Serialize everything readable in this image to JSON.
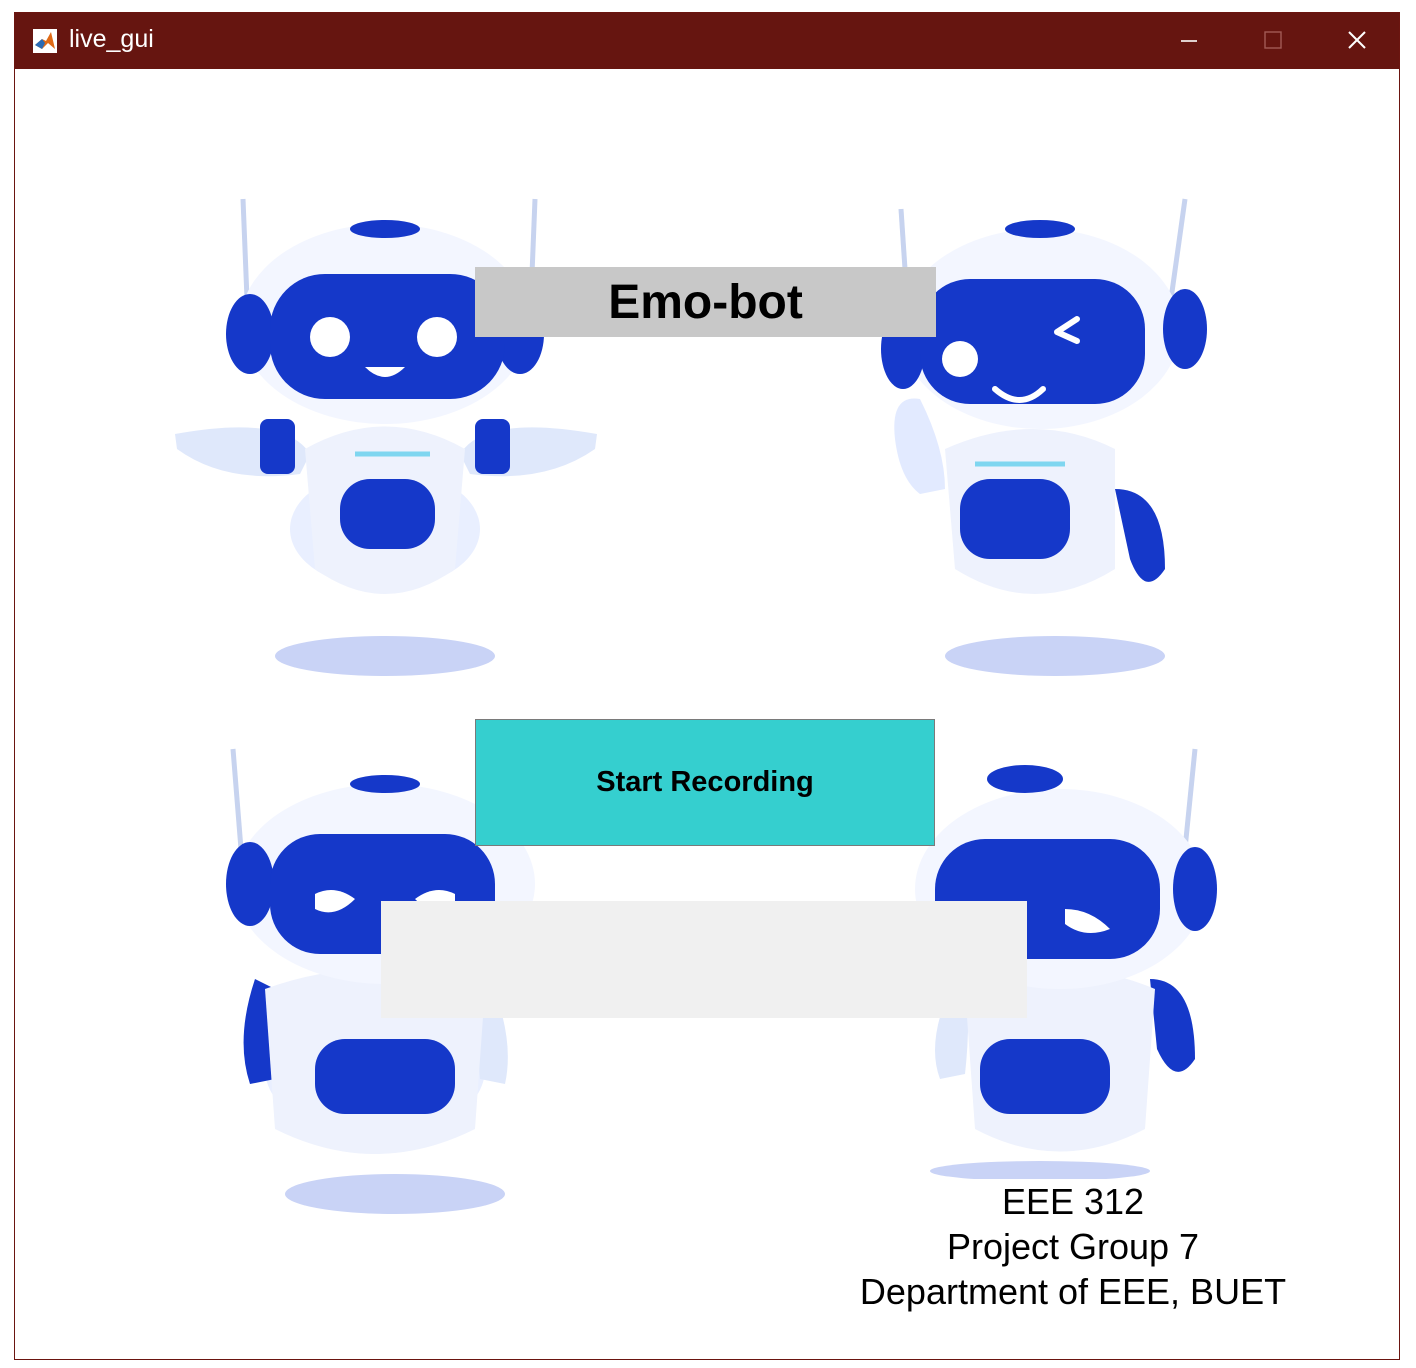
{
  "window": {
    "title": "live_gui",
    "controls": {
      "minimize": "minimize",
      "maximize": "maximize",
      "close": "close"
    }
  },
  "main": {
    "heading": "Emo-bot",
    "start_button_label": "Start Recording",
    "result_text": "",
    "credits": [
      "EEE 312",
      "Project Group 7",
      "Department of EEE, BUET"
    ]
  },
  "colors": {
    "titlebar": "#661510",
    "heading_bg": "#c8c8c8",
    "button_bg": "#35cfcf",
    "result_bg": "#f0f0f0",
    "robot_blue": "#1538c9"
  },
  "icons": [
    "matlab-icon",
    "minimize-icon",
    "maximize-icon",
    "close-icon",
    "robot-happy-image",
    "robot-wink-image",
    "robot-angry-image",
    "robot-sad-image"
  ]
}
